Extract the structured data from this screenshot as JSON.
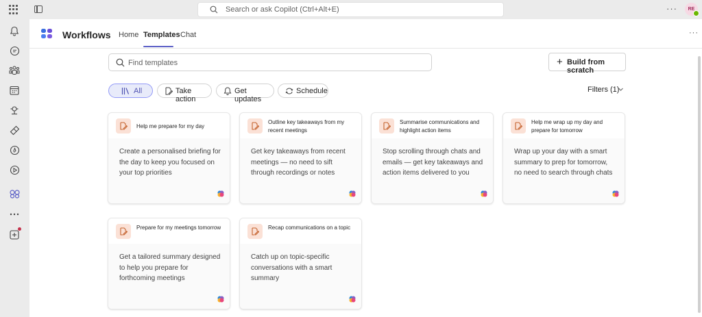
{
  "titlebar": {
    "search_placeholder": "Search or ask Copilot (Ctrl+Alt+E)",
    "avatar_initials": "RE",
    "more_label": "···"
  },
  "rail": {
    "items": [
      {
        "name": "activity",
        "icon": "bell-icon"
      },
      {
        "name": "chat",
        "icon": "chat-icon"
      },
      {
        "name": "teams",
        "icon": "teams-icon"
      },
      {
        "name": "calendar",
        "icon": "calendar-icon"
      },
      {
        "name": "calls",
        "icon": "phone-icon"
      },
      {
        "name": "onedrive",
        "icon": "diamond-icon"
      },
      {
        "name": "copilot",
        "icon": "loop-icon"
      },
      {
        "name": "play",
        "icon": "play-icon"
      },
      {
        "name": "workflows",
        "icon": "workflows-icon"
      },
      {
        "name": "more",
        "icon": "more-icon"
      },
      {
        "name": "add-apps",
        "icon": "add-icon"
      }
    ]
  },
  "app": {
    "title": "Workflows",
    "nav": [
      "Home",
      "Templates",
      "Chat"
    ],
    "active_nav": "Templates",
    "more_label": "···"
  },
  "find": {
    "placeholder": "Find templates"
  },
  "build_button": "Build from scratch",
  "chips": [
    {
      "label": "All",
      "icon": "library-icon",
      "active": true
    },
    {
      "label": "Take action",
      "icon": "edit-icon",
      "active": false
    },
    {
      "label": "Get updates",
      "icon": "bell-icon",
      "active": false
    },
    {
      "label": "Schedule",
      "icon": "refresh-icon",
      "active": false
    }
  ],
  "filters_label": "Filters (1)",
  "cards": [
    {
      "title": "Help me prepare for my day",
      "description": "Create a personalised briefing for the day to keep you focused on your top priorities"
    },
    {
      "title": "Outline key takeaways from my recent meetings",
      "description": "Get key takeaways from recent meetings — no need to sift through recordings or notes"
    },
    {
      "title": "Summarise communications and highlight action items",
      "description": "Stop scrolling through chats and emails — get key takeaways and action items delivered to you"
    },
    {
      "title": "Help me wrap up my day and prepare for tomorrow",
      "description": "Wrap up your day with a smart summary to prep for tomorrow, no need to search through chats"
    },
    {
      "title": "Prepare for my meetings tomorrow",
      "description": "Get a tailored summary designed to help you prepare for forthcoming meetings"
    },
    {
      "title": "Recap communications on a topic",
      "description": "Catch up on topic-specific conversations with a smart summary"
    }
  ],
  "colors": {
    "accent": "#5b5fc7",
    "badge_bg": "#fbe1d6",
    "badge_icon": "#c4622d"
  }
}
